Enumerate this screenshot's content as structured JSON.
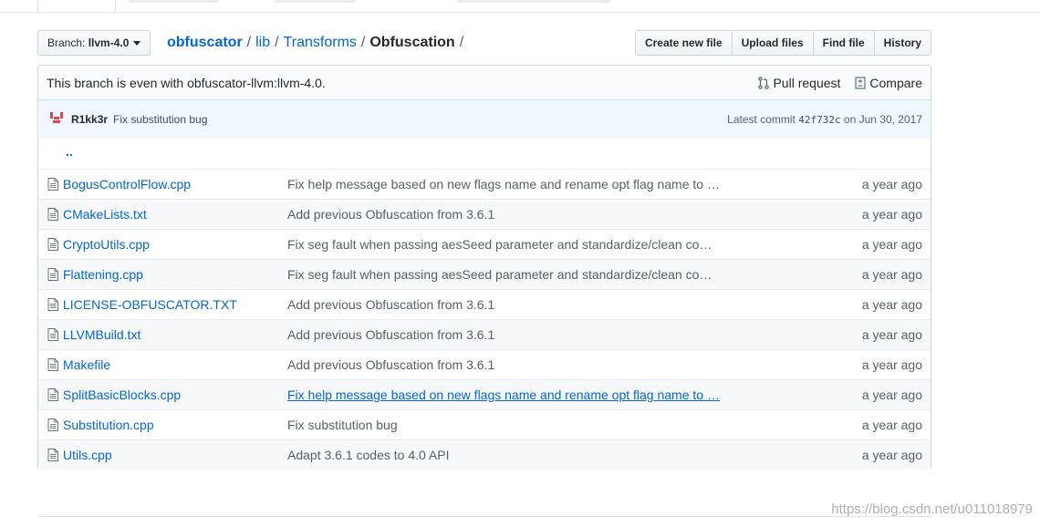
{
  "branch": {
    "prefix": "Branch:",
    "name": "llvm-4.0"
  },
  "breadcrumb": {
    "root": "obfuscator",
    "lib": "lib",
    "transforms": "Transforms",
    "current": "Obfuscation",
    "trail": "/"
  },
  "toolbar": {
    "create_new_file": "Create new file",
    "upload_files": "Upload files",
    "find_file": "Find file",
    "history": "History"
  },
  "branch_info": {
    "message": "This branch is even with obfuscator-llvm:llvm-4.0.",
    "pull_request": "Pull request",
    "compare": "Compare"
  },
  "latest_commit": {
    "author": "R1kk3r",
    "message": "Fix substitution bug",
    "label": "Latest commit",
    "sha": "42f732c",
    "date": "on Jun 30, 2017"
  },
  "up_dir": "..",
  "files": [
    {
      "name": "BogusControlFlow.cpp",
      "message": "Fix help message based on new flags name and rename opt flag name to …",
      "age": "a year ago"
    },
    {
      "name": "CMakeLists.txt",
      "message": "Add previous Obfuscation from 3.6.1",
      "age": "a year ago"
    },
    {
      "name": "CryptoUtils.cpp",
      "message": "Fix seg fault when passing aesSeed parameter and standardize/clean co…",
      "age": "a year ago"
    },
    {
      "name": "Flattening.cpp",
      "message": "Fix seg fault when passing aesSeed parameter and standardize/clean co…",
      "age": "a year ago"
    },
    {
      "name": "LICENSE-OBFUSCATOR.TXT",
      "message": "Add previous Obfuscation from 3.6.1",
      "age": "a year ago"
    },
    {
      "name": "LLVMBuild.txt",
      "message": "Add previous Obfuscation from 3.6.1",
      "age": "a year ago"
    },
    {
      "name": "Makefile",
      "message": "Add previous Obfuscation from 3.6.1",
      "age": "a year ago"
    },
    {
      "name": "SplitBasicBlocks.cpp",
      "message": "Fix help message based on new flags name and rename opt flag name to …",
      "age": "a year ago"
    },
    {
      "name": "Substitution.cpp",
      "message": "Fix substitution bug",
      "age": "a year ago"
    },
    {
      "name": "Utils.cpp",
      "message": "Adapt 3.6.1 codes to 4.0 API",
      "age": "a year ago"
    }
  ],
  "watermark": "https://blog.csdn.net/u011018979",
  "colors": {
    "link": "#0366d6",
    "commit_bg": "#f1f8ff",
    "border": "#d1d5da"
  }
}
